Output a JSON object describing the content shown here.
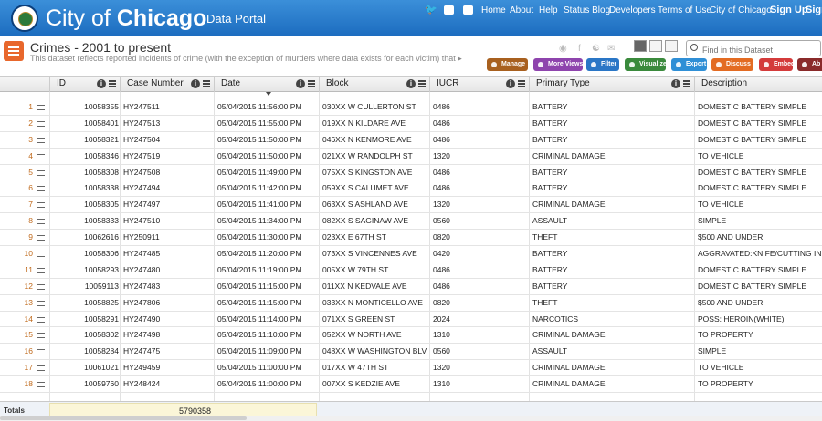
{
  "banner": {
    "logo_thin": "City of",
    "logo_bold": "Chicago",
    "portal": "Data Portal",
    "nav": [
      {
        "label": "Home",
        "name": "nav-home"
      },
      {
        "label": "About",
        "name": "nav-about"
      },
      {
        "label": "Help",
        "name": "nav-help"
      },
      {
        "label": "Status Blog",
        "name": "nav-status-blog"
      },
      {
        "label": "Developers",
        "name": "nav-developers"
      },
      {
        "label": "Terms of Use",
        "name": "nav-terms"
      },
      {
        "label": "City of Chicago",
        "name": "nav-city"
      },
      {
        "label": "Sign Up",
        "name": "nav-sign-up"
      },
      {
        "label": "Sign",
        "name": "nav-sign-in"
      }
    ]
  },
  "dataset": {
    "title": "Crimes - 2001 to present",
    "description": "This dataset reflects reported incidents of crime (with the exception of murders where data exists for each victim) that",
    "search_placeholder": "Find in this Dataset",
    "tools": [
      {
        "label": "Manage",
        "color": "#a8601f",
        "name": "manage-button"
      },
      {
        "label": "More Views",
        "color": "#8e44ad",
        "name": "more-views-button"
      },
      {
        "label": "Filter",
        "color": "#2a76c6",
        "name": "filter-button"
      },
      {
        "label": "Visualize",
        "color": "#3a8a3c",
        "name": "visualize-button"
      },
      {
        "label": "Export",
        "color": "#2f8fd6",
        "name": "export-button"
      },
      {
        "label": "Discuss",
        "color": "#e36b22",
        "name": "discuss-button"
      },
      {
        "label": "Embed",
        "color": "#d43b3b",
        "name": "embed-button"
      },
      {
        "label": "Ab",
        "color": "#8a2a2a",
        "name": "about-button"
      }
    ]
  },
  "columns": [
    {
      "label": "ID",
      "name": "col-id"
    },
    {
      "label": "Case Number",
      "name": "col-case-number"
    },
    {
      "label": "Date",
      "name": "col-date"
    },
    {
      "label": "Block",
      "name": "col-block"
    },
    {
      "label": "IUCR",
      "name": "col-iucr"
    },
    {
      "label": "Primary Type",
      "name": "col-primary-type"
    },
    {
      "label": "Description",
      "name": "col-description"
    }
  ],
  "rows": [
    {
      "n": "1",
      "id": "10058355",
      "case": "HY247511",
      "date": "05/04/2015 11:56:00 PM",
      "block": "030XX W CULLERTON ST",
      "iucr": "0486",
      "type": "BATTERY",
      "desc": "DOMESTIC BATTERY SIMPLE"
    },
    {
      "n": "2",
      "id": "10058401",
      "case": "HY247513",
      "date": "05/04/2015 11:55:00 PM",
      "block": "019XX N KILDARE AVE",
      "iucr": "0486",
      "type": "BATTERY",
      "desc": "DOMESTIC BATTERY SIMPLE"
    },
    {
      "n": "3",
      "id": "10058321",
      "case": "HY247504",
      "date": "05/04/2015 11:50:00 PM",
      "block": "046XX N KENMORE AVE",
      "iucr": "0486",
      "type": "BATTERY",
      "desc": "DOMESTIC BATTERY SIMPLE"
    },
    {
      "n": "4",
      "id": "10058346",
      "case": "HY247519",
      "date": "05/04/2015 11:50:00 PM",
      "block": "021XX W RANDOLPH ST",
      "iucr": "1320",
      "type": "CRIMINAL DAMAGE",
      "desc": "TO VEHICLE"
    },
    {
      "n": "5",
      "id": "10058308",
      "case": "HY247508",
      "date": "05/04/2015 11:49:00 PM",
      "block": "075XX S KINGSTON AVE",
      "iucr": "0486",
      "type": "BATTERY",
      "desc": "DOMESTIC BATTERY SIMPLE"
    },
    {
      "n": "6",
      "id": "10058338",
      "case": "HY247494",
      "date": "05/04/2015 11:42:00 PM",
      "block": "059XX S CALUMET AVE",
      "iucr": "0486",
      "type": "BATTERY",
      "desc": "DOMESTIC BATTERY SIMPLE"
    },
    {
      "n": "7",
      "id": "10058305",
      "case": "HY247497",
      "date": "05/04/2015 11:41:00 PM",
      "block": "063XX S ASHLAND AVE",
      "iucr": "1320",
      "type": "CRIMINAL DAMAGE",
      "desc": "TO VEHICLE"
    },
    {
      "n": "8",
      "id": "10058333",
      "case": "HY247510",
      "date": "05/04/2015 11:34:00 PM",
      "block": "082XX S SAGINAW AVE",
      "iucr": "0560",
      "type": "ASSAULT",
      "desc": "SIMPLE"
    },
    {
      "n": "9",
      "id": "10062616",
      "case": "HY250911",
      "date": "05/04/2015 11:30:00 PM",
      "block": "023XX E 67TH ST",
      "iucr": "0820",
      "type": "THEFT",
      "desc": "$500 AND UNDER"
    },
    {
      "n": "10",
      "id": "10058306",
      "case": "HY247485",
      "date": "05/04/2015 11:20:00 PM",
      "block": "073XX S VINCENNES AVE",
      "iucr": "0420",
      "type": "BATTERY",
      "desc": "AGGRAVATED:KNIFE/CUTTING IN"
    },
    {
      "n": "11",
      "id": "10058293",
      "case": "HY247480",
      "date": "05/04/2015 11:19:00 PM",
      "block": "005XX W 79TH ST",
      "iucr": "0486",
      "type": "BATTERY",
      "desc": "DOMESTIC BATTERY SIMPLE"
    },
    {
      "n": "12",
      "id": "10059113",
      "case": "HY247483",
      "date": "05/04/2015 11:15:00 PM",
      "block": "011XX N KEDVALE AVE",
      "iucr": "0486",
      "type": "BATTERY",
      "desc": "DOMESTIC BATTERY SIMPLE"
    },
    {
      "n": "13",
      "id": "10058825",
      "case": "HY247806",
      "date": "05/04/2015 11:15:00 PM",
      "block": "033XX N MONTICELLO AVE",
      "iucr": "0820",
      "type": "THEFT",
      "desc": "$500 AND UNDER"
    },
    {
      "n": "14",
      "id": "10058291",
      "case": "HY247490",
      "date": "05/04/2015 11:14:00 PM",
      "block": "071XX S GREEN ST",
      "iucr": "2024",
      "type": "NARCOTICS",
      "desc": "POSS: HEROIN(WHITE)"
    },
    {
      "n": "15",
      "id": "10058302",
      "case": "HY247498",
      "date": "05/04/2015 11:10:00 PM",
      "block": "052XX W NORTH AVE",
      "iucr": "1310",
      "type": "CRIMINAL DAMAGE",
      "desc": "TO PROPERTY"
    },
    {
      "n": "16",
      "id": "10058284",
      "case": "HY247475",
      "date": "05/04/2015 11:09:00 PM",
      "block": "048XX W WASHINGTON BLVD",
      "iucr": "0560",
      "type": "ASSAULT",
      "desc": "SIMPLE"
    },
    {
      "n": "17",
      "id": "10061021",
      "case": "HY249459",
      "date": "05/04/2015 11:00:00 PM",
      "block": "017XX W 47TH ST",
      "iucr": "1320",
      "type": "CRIMINAL DAMAGE",
      "desc": "TO VEHICLE"
    },
    {
      "n": "18",
      "id": "10059760",
      "case": "HY248424",
      "date": "05/04/2015 11:00:00 PM",
      "block": "007XX S KEDZIE AVE",
      "iucr": "1310",
      "type": "CRIMINAL DAMAGE",
      "desc": "TO PROPERTY"
    }
  ],
  "footer": {
    "label": "Totals",
    "value": "5790358"
  }
}
